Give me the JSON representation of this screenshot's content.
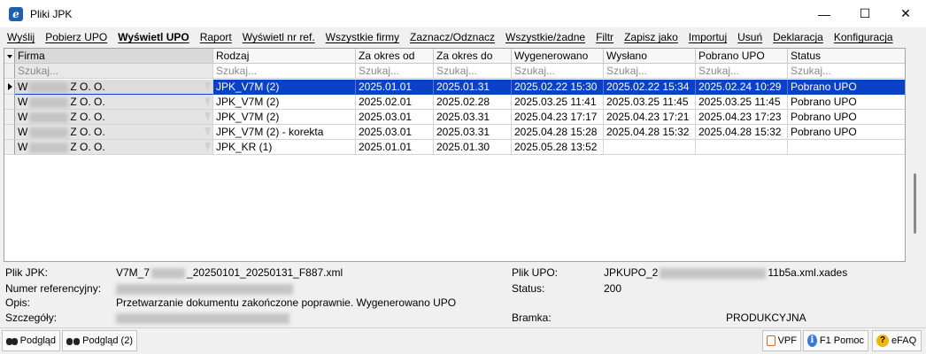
{
  "window": {
    "title": "Pliki JPK",
    "minimize": "—",
    "maximize": "☐",
    "close": "✕"
  },
  "menu": [
    {
      "label": "Wyślij"
    },
    {
      "label": "Pobierz UPO"
    },
    {
      "label": "Wyświetl UPO"
    },
    {
      "label": "Raport"
    },
    {
      "label": "Wyświetl nr ref."
    },
    {
      "label": "Wszystkie firmy"
    },
    {
      "label": "Zaznacz/Odznacz"
    },
    {
      "label": "Wszystkie/żadne"
    },
    {
      "label": "Filtr"
    },
    {
      "label": "Zapisz jako"
    },
    {
      "label": "Importuj"
    },
    {
      "label": "Usuń"
    },
    {
      "label": "Deklaracja"
    },
    {
      "label": "Konfiguracja"
    }
  ],
  "grid": {
    "columns": [
      "Firma",
      "Rodzaj",
      "Za okres od",
      "Za okres do",
      "Wygenerowano",
      "Wysłano",
      "Pobrano UPO",
      "Status"
    ],
    "filter_placeholder": "Szukaj...",
    "rows": [
      {
        "firma_a": "W",
        "firma_b": "Z O. O.",
        "rodzaj": "JPK_V7M (2)",
        "od": "2025.01.01",
        "do": "2025.01.31",
        "wygenerowano": "2025.02.22 15:30",
        "wyslano": "2025.02.22 15:34",
        "pobrano": "2025.02.24 10:29",
        "status": "Pobrano UPO"
      },
      {
        "firma_a": "W",
        "firma_b": "Z O. O.",
        "rodzaj": "JPK_V7M (2)",
        "od": "2025.02.01",
        "do": "2025.02.28",
        "wygenerowano": "2025.03.25 11:41",
        "wyslano": "2025.03.25 11:45",
        "pobrano": "2025.03.25 11:45",
        "status": "Pobrano UPO"
      },
      {
        "firma_a": "W",
        "firma_b": "Z O. O.",
        "rodzaj": "JPK_V7M (2)",
        "od": "2025.03.01",
        "do": "2025.03.31",
        "wygenerowano": "2025.04.23 17:17",
        "wyslano": "2025.04.23 17:21",
        "pobrano": "2025.04.23 17:23",
        "status": "Pobrano UPO"
      },
      {
        "firma_a": "W",
        "firma_b": "Z O. O.",
        "rodzaj": "JPK_V7M (2) - korekta",
        "od": "2025.03.01",
        "do": "2025.03.31",
        "wygenerowano": "2025.04.28 15:28",
        "wyslano": "2025.04.28 15:32",
        "pobrano": "2025.04.28 15:32",
        "status": "Pobrano UPO"
      },
      {
        "firma_a": "W",
        "firma_b": "Z O. O.",
        "rodzaj": "JPK_KR (1)",
        "od": "2025.01.01",
        "do": "2025.01.30",
        "wygenerowano": "2025.05.28 13:52",
        "wyslano": "",
        "pobrano": "",
        "status": ""
      }
    ]
  },
  "details": {
    "plik_jpk_label": "Plik JPK:",
    "plik_jpk_value": "V7M_7",
    "plik_jpk_value_end": "_20250101_20250131_F887.xml",
    "numer_label": "Numer referencyjny:",
    "opis_label": "Opis:",
    "opis_value": "Przetwarzanie dokumentu zakończone poprawnie. Wygenerowano UPO",
    "szczegoly_label": "Szczegóły:",
    "plik_upo_label": "Plik UPO:",
    "plik_upo_value": "JPKUPO_2",
    "plik_upo_value_end": "11b5a.xml.xades",
    "status_label": "Status:",
    "status_value": "200",
    "bramka_label": "Bramka:",
    "bramka_value": "PRODUKCYJNA"
  },
  "toolbar": {
    "podglad": "Podgląd",
    "podglad2": "Podgląd (2)",
    "vpf": "VPF",
    "pomoc": "F1 Pomoc",
    "efaq": "eFAQ"
  },
  "colors": {
    "selection": "#0b41c9"
  }
}
